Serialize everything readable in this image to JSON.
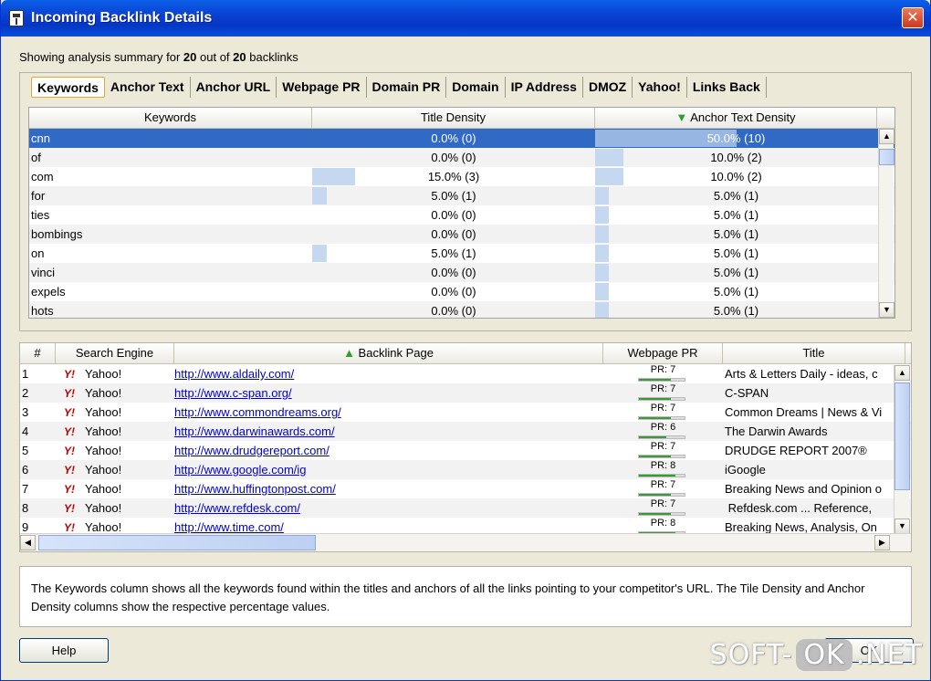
{
  "window": {
    "title": "Incoming Backlink Details"
  },
  "summary": {
    "prefix": "Showing analysis summary for",
    "shown": "20",
    "middle": "out of",
    "total": "20",
    "suffix": "backlinks"
  },
  "tabs": [
    "Keywords",
    "Anchor Text",
    "Anchor URL",
    "Webpage PR",
    "Domain PR",
    "Domain",
    "IP Address",
    "DMOZ",
    "Yahoo!",
    "Links Back"
  ],
  "keywords_table": {
    "columns": [
      "Keywords",
      "Title Density",
      "Anchor Text Density"
    ],
    "sort_column_index": 2,
    "sort_dir": "desc",
    "rows": [
      {
        "keyword": "cnn",
        "title": "0.0% (0)",
        "title_pct": 0,
        "anchor": "50.0% (10)",
        "anchor_pct": 50,
        "selected": true
      },
      {
        "keyword": "of",
        "title": "0.0% (0)",
        "title_pct": 0,
        "anchor": "10.0% (2)",
        "anchor_pct": 10
      },
      {
        "keyword": "com",
        "title": "15.0% (3)",
        "title_pct": 15,
        "anchor": "10.0% (2)",
        "anchor_pct": 10
      },
      {
        "keyword": "for",
        "title": "5.0% (1)",
        "title_pct": 5,
        "anchor": "5.0% (1)",
        "anchor_pct": 5
      },
      {
        "keyword": "ties",
        "title": "0.0% (0)",
        "title_pct": 0,
        "anchor": "5.0% (1)",
        "anchor_pct": 5
      },
      {
        "keyword": "bombings",
        "title": "0.0% (0)",
        "title_pct": 0,
        "anchor": "5.0% (1)",
        "anchor_pct": 5
      },
      {
        "keyword": "on",
        "title": "5.0% (1)",
        "title_pct": 5,
        "anchor": "5.0% (1)",
        "anchor_pct": 5
      },
      {
        "keyword": "vinci",
        "title": "0.0% (0)",
        "title_pct": 0,
        "anchor": "5.0% (1)",
        "anchor_pct": 5
      },
      {
        "keyword": "expels",
        "title": "0.0% (0)",
        "title_pct": 0,
        "anchor": "5.0% (1)",
        "anchor_pct": 5
      },
      {
        "keyword": "hots",
        "title": "0.0% (0)",
        "title_pct": 0,
        "anchor": "5.0% (1)",
        "anchor_pct": 5
      }
    ]
  },
  "backlinks_table": {
    "columns": [
      "#",
      "Search Engine",
      "Backlink Page",
      "Webpage PR",
      "Title"
    ],
    "sort_column_index": 2,
    "sort_dir": "asc",
    "rows": [
      {
        "n": "1",
        "engine": "Yahoo!",
        "url": "http://www.aldaily.com/",
        "pr": "PR: 7",
        "pr_value": 7,
        "title": "Arts & Letters Daily - ideas, c"
      },
      {
        "n": "2",
        "engine": "Yahoo!",
        "url": "http://www.c-span.org/",
        "pr": "PR: 7",
        "pr_value": 7,
        "title": "C-SPAN"
      },
      {
        "n": "3",
        "engine": "Yahoo!",
        "url": "http://www.commondreams.org/",
        "pr": "PR: 7",
        "pr_value": 7,
        "title": "Common Dreams | News & Vi"
      },
      {
        "n": "4",
        "engine": "Yahoo!",
        "url": "http://www.darwinawards.com/",
        "pr": "PR: 6",
        "pr_value": 6,
        "title": "The Darwin Awards"
      },
      {
        "n": "5",
        "engine": "Yahoo!",
        "url": "http://www.drudgereport.com/",
        "pr": "PR: 7",
        "pr_value": 7,
        "title": "DRUDGE REPORT 2007®"
      },
      {
        "n": "6",
        "engine": "Yahoo!",
        "url": "http://www.google.com/ig",
        "pr": "PR: 8",
        "pr_value": 8,
        "title": "iGoogle"
      },
      {
        "n": "7",
        "engine": "Yahoo!",
        "url": "http://www.huffingtonpost.com/",
        "pr": "PR: 7",
        "pr_value": 7,
        "title": "Breaking News and Opinion o"
      },
      {
        "n": "8",
        "engine": "Yahoo!",
        "url": "http://www.refdesk.com/",
        "pr": "PR: 7",
        "pr_value": 7,
        "title": " Refdesk.com ... Reference,"
      },
      {
        "n": "9",
        "engine": "Yahoo!",
        "url": "http://www.time.com/",
        "pr": "PR: 8",
        "pr_value": 8,
        "title": "Breaking News, Analysis, On"
      }
    ]
  },
  "engine_icon": "yahoo-y-icon",
  "description": "The Keywords column shows all the keywords found within the titles and anchors of all the links pointing to your competitor's URL. The Tile Density and Anchor Density columns show the respective percentage values.",
  "buttons": {
    "help": "Help",
    "ok": "OK"
  },
  "watermark": {
    "left": "SOFT-",
    "ok": "OK",
    "right": ".NET"
  },
  "colors": {
    "titlebar": "#0a3fd0",
    "selection": "#316ac5",
    "density_bar": "#c6d8ef",
    "link": "#0000cc",
    "pr_bar": "#3a9a3a",
    "sort_arrow": "#2e9e2e"
  }
}
